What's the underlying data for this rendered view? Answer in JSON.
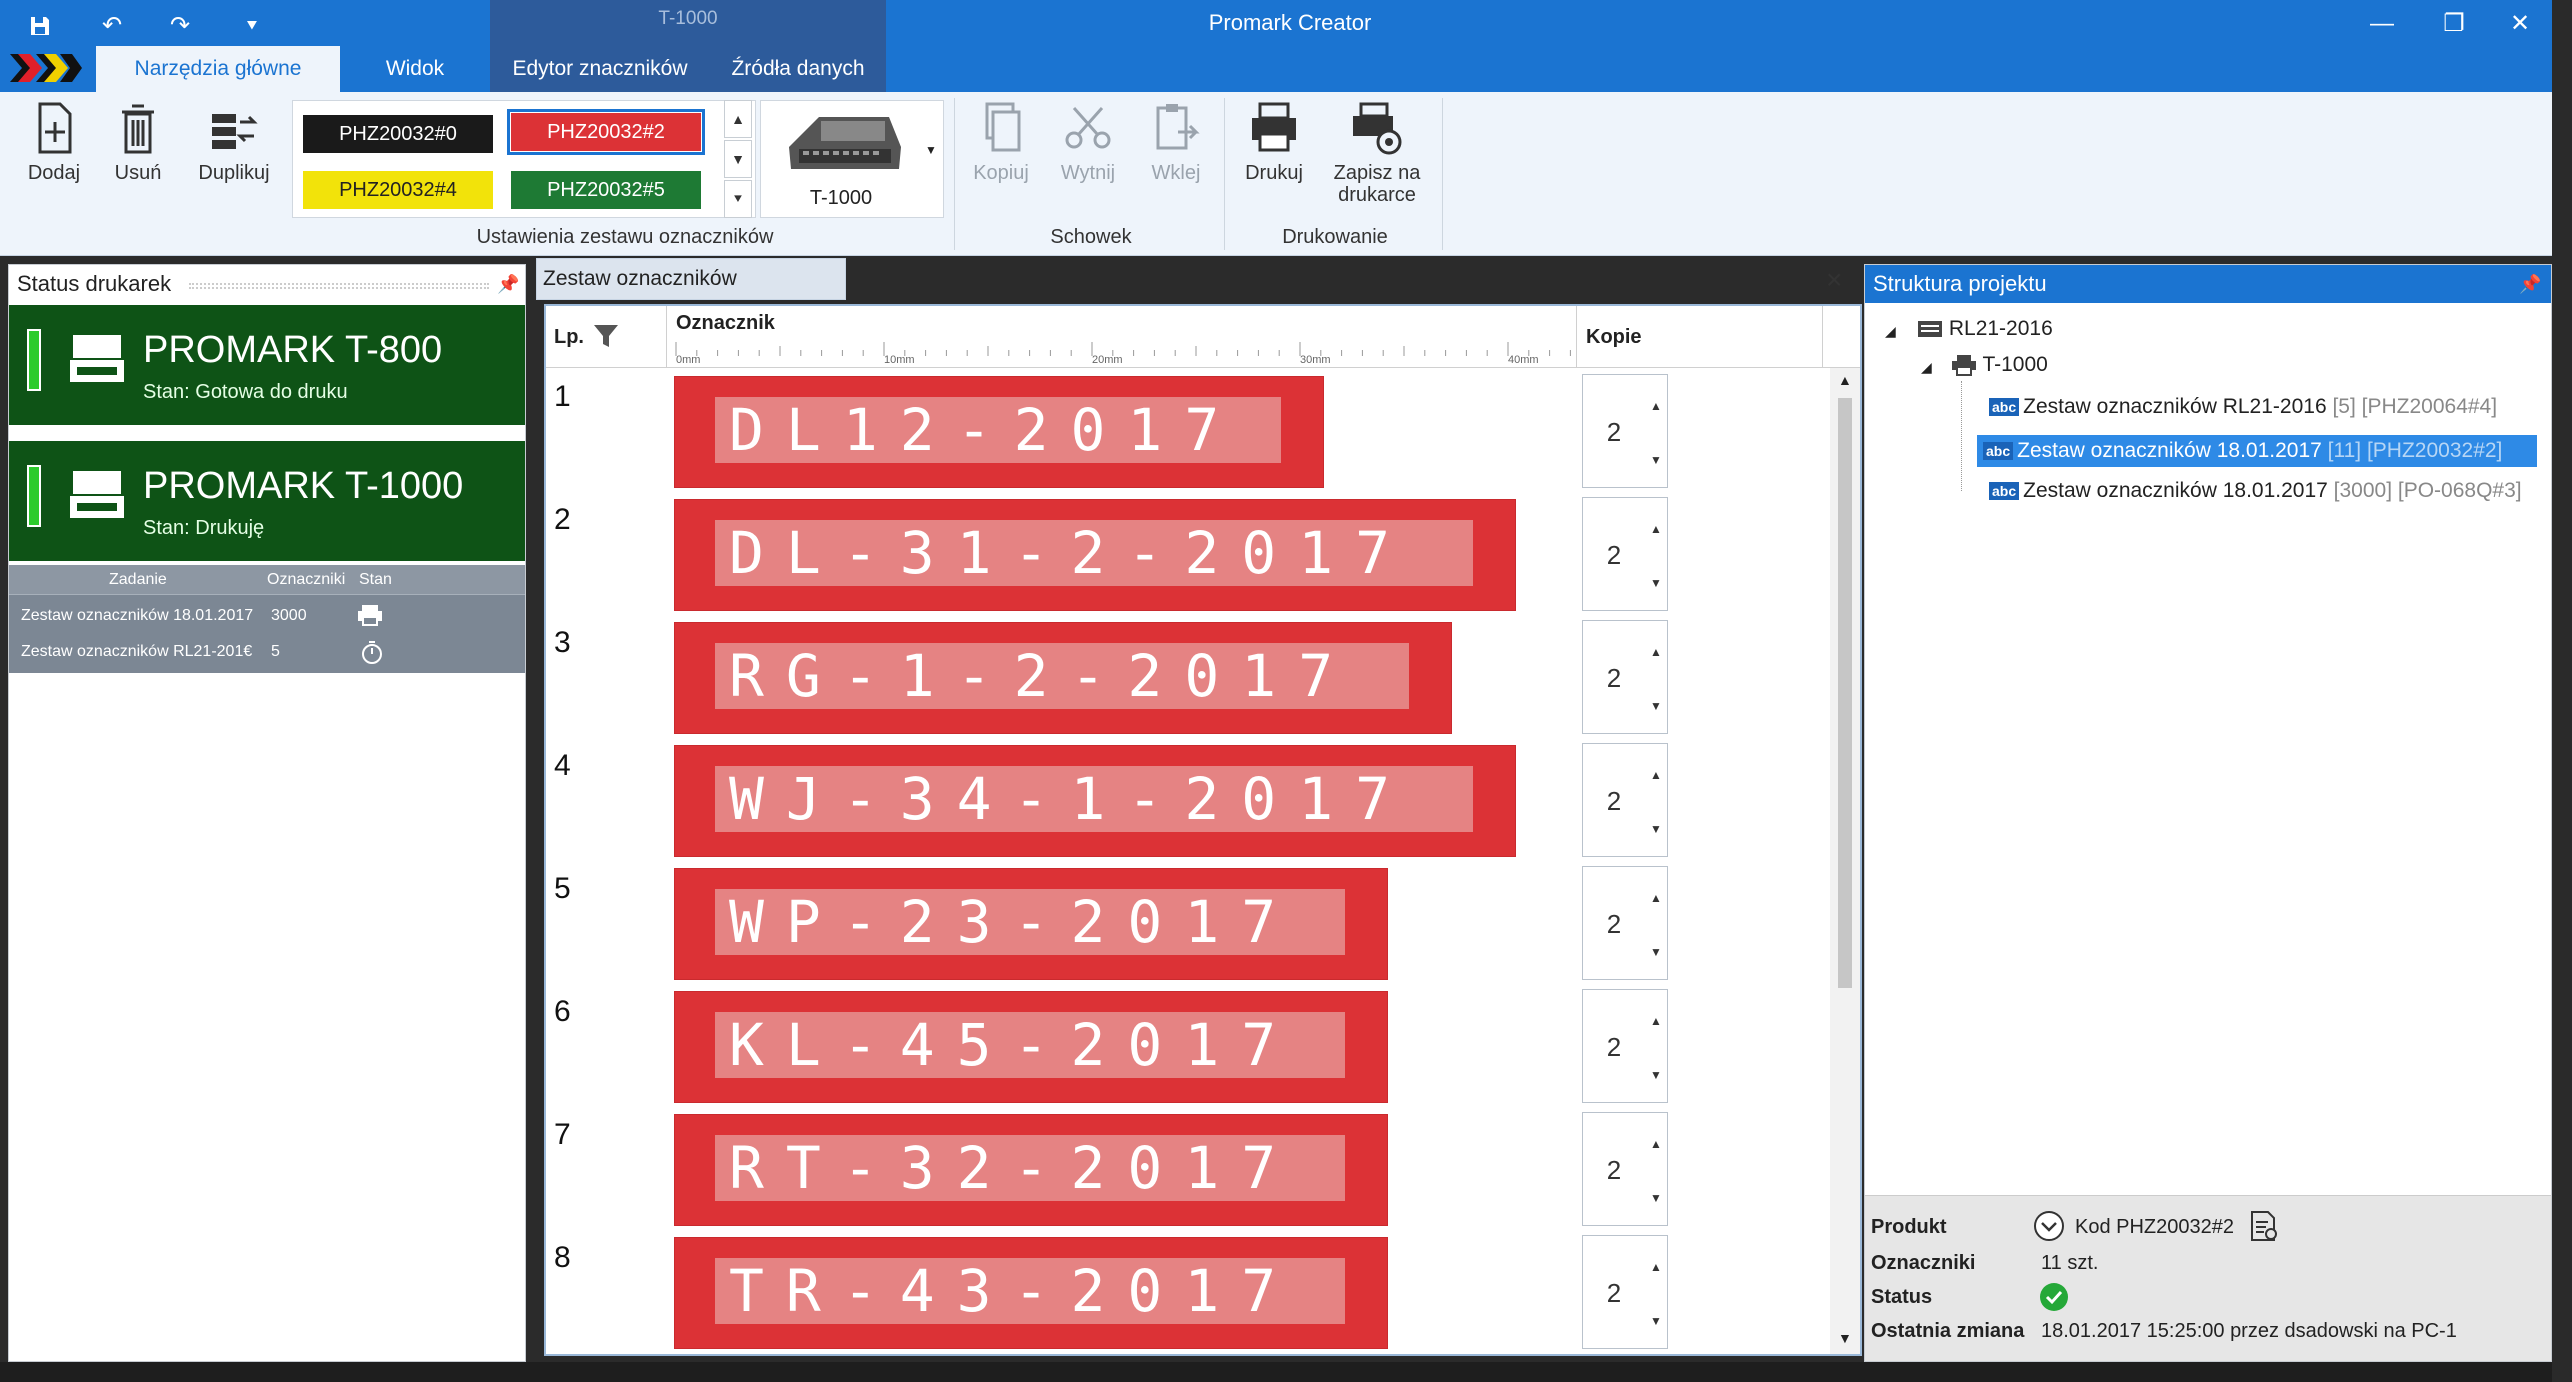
{
  "app": {
    "title": "Promark Creator",
    "context_tab_group": "T-1000",
    "window_controls": [
      "minimize-icon",
      "restore-icon",
      "close-icon"
    ],
    "quick_access": [
      "save-icon",
      "undo-icon",
      "redo-icon",
      "customize-icon"
    ]
  },
  "tabs": [
    {
      "label": "Narzędzia główne",
      "active": true
    },
    {
      "label": "Widok",
      "active": false
    },
    {
      "label": "Edytor znaczników",
      "active": false
    },
    {
      "label": "Źródła danych",
      "active": false
    }
  ],
  "ribbon": {
    "add": "Dodaj",
    "delete": "Usuń",
    "duplicate": "Duplikuj",
    "swatches": [
      {
        "label": "PHZ20032#0",
        "bg": "#1a1a1a",
        "fg": "#ffffff"
      },
      {
        "label": "PHZ20032#2",
        "bg": "#dc3236",
        "fg": "#ffffff"
      },
      {
        "label": "PHZ20032#4",
        "bg": "#f2e30a",
        "fg": "#222222"
      },
      {
        "label": "PHZ20032#5",
        "bg": "#1e7a34",
        "fg": "#ffffff"
      }
    ],
    "printer_label": "T-1000",
    "group_set": "Ustawienia zestawu oznaczników",
    "copy": "Kopiuj",
    "cut": "Wytnij",
    "paste": "Wklej",
    "group_clipboard": "Schowek",
    "print": "Drukuj",
    "save_on_printer": "Zapisz na drukarce",
    "group_print": "Drukowanie"
  },
  "left_panel": {
    "title": "Status drukarek",
    "printers": [
      {
        "name": "PROMARK T-800",
        "status": "Stan:  Gotowa do druku"
      },
      {
        "name": "PROMARK T-1000",
        "status": "Stan:  Drukuję"
      }
    ],
    "jobs": {
      "headers": [
        "Zadanie",
        "Oznaczniki",
        "Stan"
      ],
      "rows": [
        {
          "task": "Zestaw oznaczników 18.01.2017",
          "count": "3000",
          "state_icon": "printer-icon"
        },
        {
          "task": "Zestaw oznaczników RL21-201€",
          "count": "5",
          "state_icon": "timer-icon"
        }
      ]
    }
  },
  "document": {
    "tab_title": "Zestaw oznaczników 18.01.2017",
    "col_lp": "Lp.",
    "col_marker": "Oznacznik",
    "col_copies": "Kopie",
    "ruler": [
      "0mm",
      "10mm",
      "20mm",
      "30mm",
      "40mm"
    ],
    "rows": [
      {
        "lp": "1",
        "text": "DL12-2017",
        "copies": "2"
      },
      {
        "lp": "2",
        "text": "DL-31-2-2017",
        "copies": "2"
      },
      {
        "lp": "3",
        "text": "RG-1-2-2017",
        "copies": "2"
      },
      {
        "lp": "4",
        "text": "WJ-34-1-2017",
        "copies": "2"
      },
      {
        "lp": "5",
        "text": "WP-23-2017",
        "copies": "2"
      },
      {
        "lp": "6",
        "text": "KL-45-2017",
        "copies": "2"
      },
      {
        "lp": "7",
        "text": "RT-32-2017",
        "copies": "2"
      },
      {
        "lp": "8",
        "text": "TR-43-2017",
        "copies": "2"
      }
    ]
  },
  "right_panel": {
    "title": "Struktura projektu",
    "tree": {
      "root": "RL21-2016",
      "printer": "T-1000",
      "items": [
        {
          "name": "Zestaw oznaczników RL21-2016",
          "detail": "[5] [PHZ20064#4]",
          "selected": false
        },
        {
          "name": "Zestaw oznaczników 18.01.2017",
          "detail": "[11] [PHZ20032#2]",
          "selected": true
        },
        {
          "name": "Zestaw oznaczników 18.01.2017",
          "detail": "[3000] [PO-068Q#3]",
          "selected": false
        }
      ]
    },
    "props": {
      "product_label": "Produkt",
      "product_value": "Kod PHZ20032#2",
      "markers_label": "Oznaczniki",
      "markers_value": "11 szt.",
      "status_label": "Status",
      "last_change_label": "Ostatnia zmiana",
      "last_change_value": "18.01.2017 15:25:00 przez dsadowski na PC-1"
    }
  }
}
